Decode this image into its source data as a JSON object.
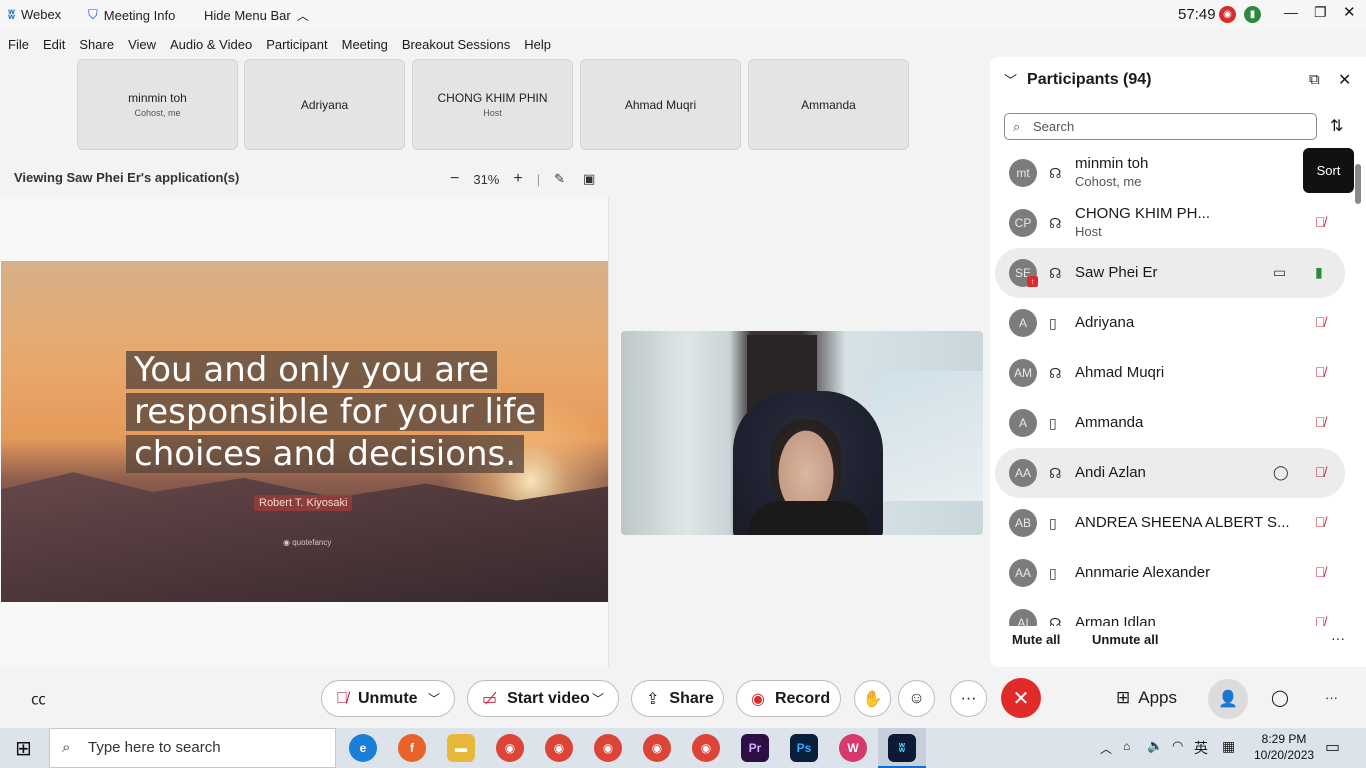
{
  "titlebar": {
    "app_name": "Webex",
    "meeting_info": "Meeting Info",
    "hide_menu": "Hide Menu Bar",
    "timer": "57:49"
  },
  "menu": [
    "File",
    "Edit",
    "Share",
    "View",
    "Audio & Video",
    "Participant",
    "Meeting",
    "Breakout Sessions",
    "Help"
  ],
  "video_tiles": [
    {
      "name": "minmin toh",
      "role": "Cohost, me"
    },
    {
      "name": "Adriyana",
      "role": ""
    },
    {
      "name": "CHONG KHIM PHIN",
      "role": "Host"
    },
    {
      "name": "Ahmad Muqri",
      "role": ""
    },
    {
      "name": "Ammanda",
      "role": ""
    }
  ],
  "share": {
    "viewing": "Viewing Saw Phei Er's application(s)",
    "zoom": "31%"
  },
  "slide": {
    "quote_lines": [
      "You and only you are",
      "responsible for your life",
      "choices and decisions."
    ],
    "author": "Robert T. Kiyosaki",
    "watermark": "◉ quotefancy"
  },
  "panel": {
    "title": "Participants (94)",
    "search_placeholder": "Search",
    "sort_tooltip": "Sort",
    "mute_all": "Mute all",
    "unmute_all": "Unmute all",
    "participants": [
      {
        "initials": "mt",
        "name": "minmin toh",
        "role": "Cohost, me",
        "device": "headset",
        "mic": "none"
      },
      {
        "initials": "CP",
        "name": "CHONG KHIM PH...",
        "role": "Host",
        "device": "headset",
        "mic": "muted"
      },
      {
        "initials": "SE",
        "name": "Saw Phei Er",
        "role": "",
        "device": "headset",
        "mic": "on",
        "extra": "video-icon",
        "highlight": true
      },
      {
        "initials": "A",
        "name": "Adriyana",
        "role": "",
        "device": "phone",
        "mic": "muted"
      },
      {
        "initials": "AM",
        "name": "Ahmad Muqri",
        "role": "",
        "device": "headset",
        "mic": "muted"
      },
      {
        "initials": "A",
        "name": "Ammanda",
        "role": "",
        "device": "phone",
        "mic": "muted"
      },
      {
        "initials": "AA",
        "name": "Andi Azlan",
        "role": "",
        "device": "headset",
        "mic": "muted",
        "extra": "chat-icon",
        "highlight": true
      },
      {
        "initials": "AB",
        "name": "ANDREA SHEENA ALBERT S...",
        "role": "",
        "device": "phone",
        "mic": "muted"
      },
      {
        "initials": "AA",
        "name": "Annmarie Alexander",
        "role": "",
        "device": "phone",
        "mic": "muted"
      },
      {
        "initials": "AI",
        "name": "Arman Idlan",
        "role": "",
        "device": "headset",
        "mic": "muted"
      }
    ]
  },
  "controls": {
    "unmute": "Unmute",
    "start_video": "Start video",
    "share": "Share",
    "record": "Record",
    "apps": "Apps"
  },
  "taskbar": {
    "search_placeholder": "Type here to search",
    "time": "8:29 PM",
    "date": "10/20/2023",
    "ime": "英"
  },
  "colors": {
    "mic_muted": "#c0243b",
    "mic_on": "#2a8a3a",
    "end_call": "#e12b2b"
  }
}
